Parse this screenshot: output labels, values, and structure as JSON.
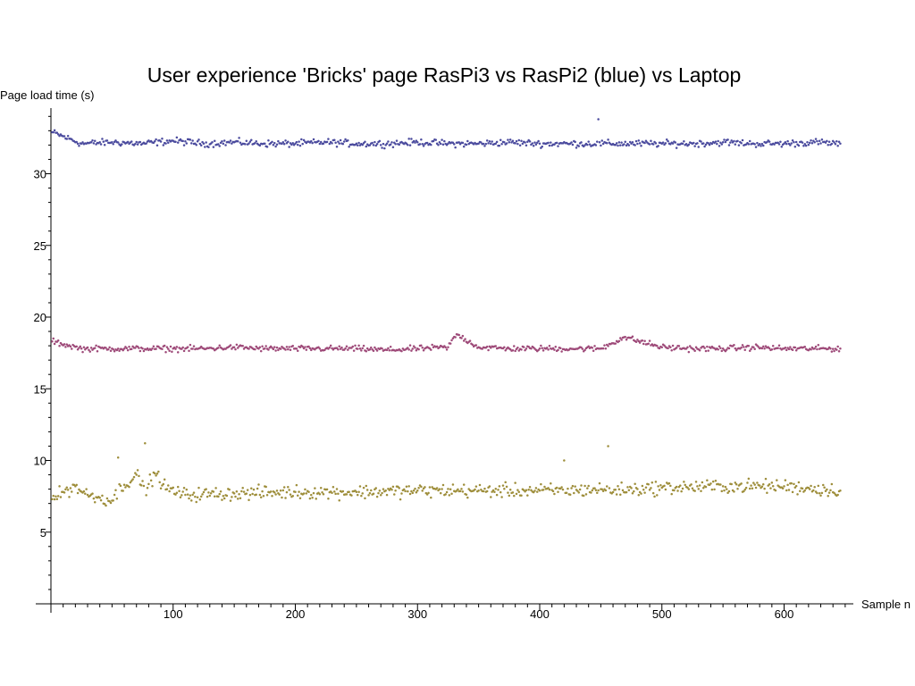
{
  "chart_data": {
    "type": "scatter",
    "title": "User experience 'Bricks' page RasPi3 vs RasPi2 (blue) vs Laptop",
    "xlabel": "Sample n",
    "ylabel": "Page load time (s)",
    "xlim": [
      0,
      655
    ],
    "ylim": [
      0,
      34.5
    ],
    "x_ticks": [
      100,
      200,
      300,
      400,
      500,
      600
    ],
    "y_ticks": [
      5,
      10,
      15,
      20,
      25,
      30
    ],
    "n_samples": 646,
    "grid": false,
    "legend": "none",
    "series": [
      {
        "color": "#4b4b9e",
        "x_range": [
          1,
          646
        ],
        "values_by_x": [
          {
            "x": 1,
            "y": 32.9
          },
          {
            "x": 25,
            "y": 32.1
          },
          {
            "x": 50,
            "y": 32.2
          },
          {
            "x": 75,
            "y": 32.1
          },
          {
            "x": 100,
            "y": 32.3
          },
          {
            "x": 125,
            "y": 32.1
          },
          {
            "x": 150,
            "y": 32.2
          },
          {
            "x": 175,
            "y": 32.1
          },
          {
            "x": 200,
            "y": 32.1
          },
          {
            "x": 225,
            "y": 32.2
          },
          {
            "x": 250,
            "y": 32.1
          },
          {
            "x": 275,
            "y": 32.1
          },
          {
            "x": 300,
            "y": 32.2
          },
          {
            "x": 325,
            "y": 32.1
          },
          {
            "x": 350,
            "y": 32.1
          },
          {
            "x": 375,
            "y": 32.2
          },
          {
            "x": 400,
            "y": 32.1
          },
          {
            "x": 425,
            "y": 32.1
          },
          {
            "x": 448,
            "y": 33.8
          },
          {
            "x": 475,
            "y": 32.1
          },
          {
            "x": 500,
            "y": 32.1
          },
          {
            "x": 525,
            "y": 32.1
          },
          {
            "x": 550,
            "y": 32.2
          },
          {
            "x": 575,
            "y": 32.1
          },
          {
            "x": 600,
            "y": 32.1
          },
          {
            "x": 625,
            "y": 32.2
          },
          {
            "x": 646,
            "y": 32.1
          }
        ],
        "mean": 32.1,
        "spread": 0.35
      },
      {
        "color": "#9e4a79",
        "x_range": [
          1,
          646
        ],
        "values_by_x": [
          {
            "x": 1,
            "y": 18.3
          },
          {
            "x": 25,
            "y": 17.8
          },
          {
            "x": 50,
            "y": 17.8
          },
          {
            "x": 75,
            "y": 17.8
          },
          {
            "x": 100,
            "y": 17.8
          },
          {
            "x": 125,
            "y": 17.8
          },
          {
            "x": 150,
            "y": 17.9
          },
          {
            "x": 175,
            "y": 17.8
          },
          {
            "x": 200,
            "y": 17.8
          },
          {
            "x": 225,
            "y": 17.8
          },
          {
            "x": 250,
            "y": 17.8
          },
          {
            "x": 275,
            "y": 17.7
          },
          {
            "x": 300,
            "y": 17.8
          },
          {
            "x": 325,
            "y": 17.9
          },
          {
            "x": 332,
            "y": 18.8
          },
          {
            "x": 350,
            "y": 17.9
          },
          {
            "x": 375,
            "y": 17.8
          },
          {
            "x": 400,
            "y": 17.8
          },
          {
            "x": 425,
            "y": 17.8
          },
          {
            "x": 450,
            "y": 17.8
          },
          {
            "x": 469,
            "y": 18.6
          },
          {
            "x": 500,
            "y": 17.9
          },
          {
            "x": 525,
            "y": 17.8
          },
          {
            "x": 550,
            "y": 17.8
          },
          {
            "x": 575,
            "y": 17.9
          },
          {
            "x": 600,
            "y": 17.8
          },
          {
            "x": 625,
            "y": 17.8
          },
          {
            "x": 646,
            "y": 17.8
          }
        ],
        "mean": 17.8,
        "spread": 0.3
      },
      {
        "color": "#9e8e3b",
        "x_range": [
          1,
          646
        ],
        "values_by_x": [
          {
            "x": 1,
            "y": 7.3
          },
          {
            "x": 10,
            "y": 7.8
          },
          {
            "x": 20,
            "y": 8.2
          },
          {
            "x": 30,
            "y": 7.6
          },
          {
            "x": 40,
            "y": 7.4
          },
          {
            "x": 50,
            "y": 7.2
          },
          {
            "x": 55,
            "y": 10.2
          },
          {
            "x": 60,
            "y": 8.3
          },
          {
            "x": 70,
            "y": 9.0
          },
          {
            "x": 77,
            "y": 11.2
          },
          {
            "x": 85,
            "y": 9.1
          },
          {
            "x": 95,
            "y": 8.0
          },
          {
            "x": 110,
            "y": 7.6
          },
          {
            "x": 150,
            "y": 7.7
          },
          {
            "x": 200,
            "y": 7.8
          },
          {
            "x": 250,
            "y": 7.8
          },
          {
            "x": 300,
            "y": 7.9
          },
          {
            "x": 350,
            "y": 7.9
          },
          {
            "x": 400,
            "y": 7.9
          },
          {
            "x": 420,
            "y": 10.0
          },
          {
            "x": 450,
            "y": 8.0
          },
          {
            "x": 456,
            "y": 11.0
          },
          {
            "x": 500,
            "y": 8.1
          },
          {
            "x": 550,
            "y": 8.2
          },
          {
            "x": 600,
            "y": 8.2
          },
          {
            "x": 646,
            "y": 7.9
          }
        ],
        "mean": 7.9,
        "spread": 0.7
      }
    ]
  }
}
